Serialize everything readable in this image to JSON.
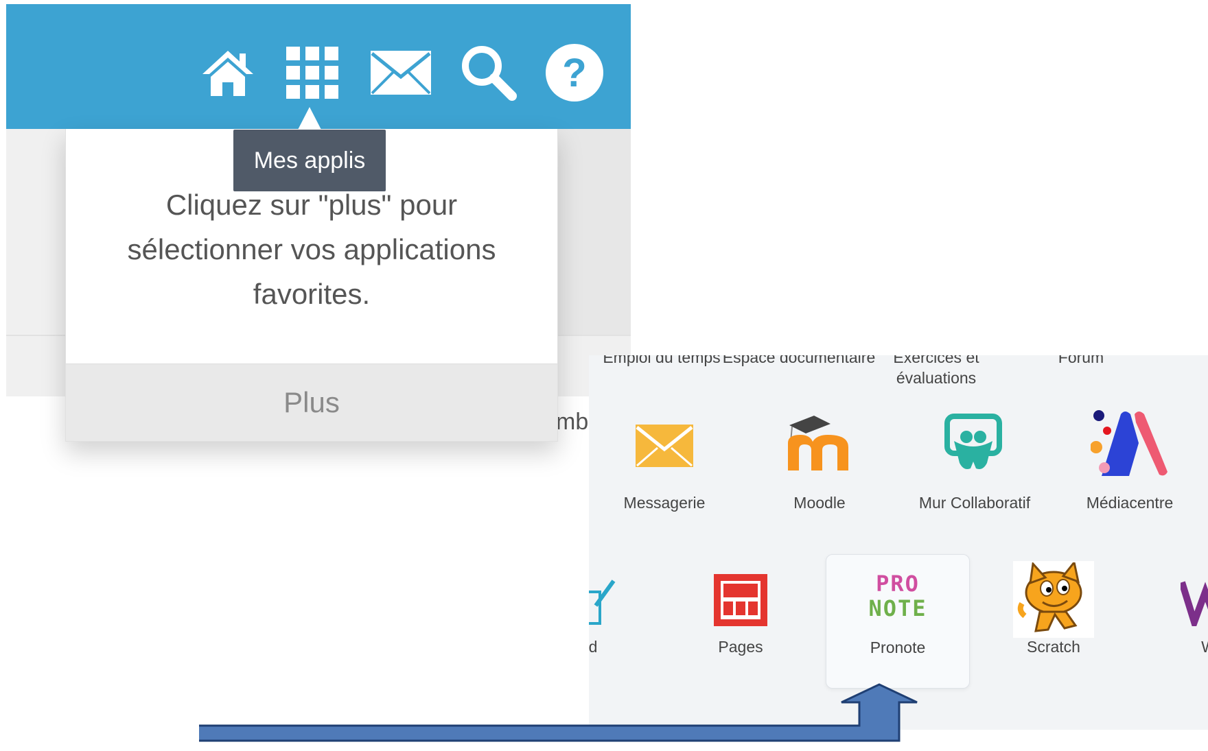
{
  "topbar": {
    "icons": [
      "home-icon",
      "apps-grid-icon",
      "mail-icon",
      "search-icon",
      "help-icon"
    ],
    "color": "#3da3d2"
  },
  "tooltip": {
    "text": "Mes applis"
  },
  "dropdown": {
    "message_line1": "Cliquez sur \"plus\" pour",
    "message_line2": "sélectionner vos applications",
    "message_line3": "favorites.",
    "plus_label": "Plus"
  },
  "background": {
    "cut_text": "mb"
  },
  "apps": {
    "row1": [
      {
        "label": "Emploi du temps"
      },
      {
        "label": "Espace documentaire"
      },
      {
        "label": "Exercices et évaluations"
      },
      {
        "label": "Forum"
      }
    ],
    "row2": [
      {
        "label": "Messagerie",
        "icon": "envelope-icon"
      },
      {
        "label": "Moodle",
        "icon": "moodle-icon"
      },
      {
        "label": "Mur Collaboratif",
        "icon": "padlet-icon"
      },
      {
        "label": "Médiacentre",
        "icon": "mediacentre-icon"
      }
    ],
    "row3": [
      {
        "label": "d",
        "icon": "pencil-icon"
      },
      {
        "label": "Pages",
        "icon": "pages-icon"
      },
      {
        "label": "Pronote",
        "icon": "pronote-icon",
        "logo_line1": "PRO",
        "logo_line2": "NOTE"
      },
      {
        "label": "Scratch",
        "icon": "scratch-cat-icon"
      },
      {
        "label": "W",
        "icon": "wiki-icon"
      }
    ]
  },
  "arrow": {
    "color": "#4f7ab8",
    "border": "#1f3f73"
  }
}
